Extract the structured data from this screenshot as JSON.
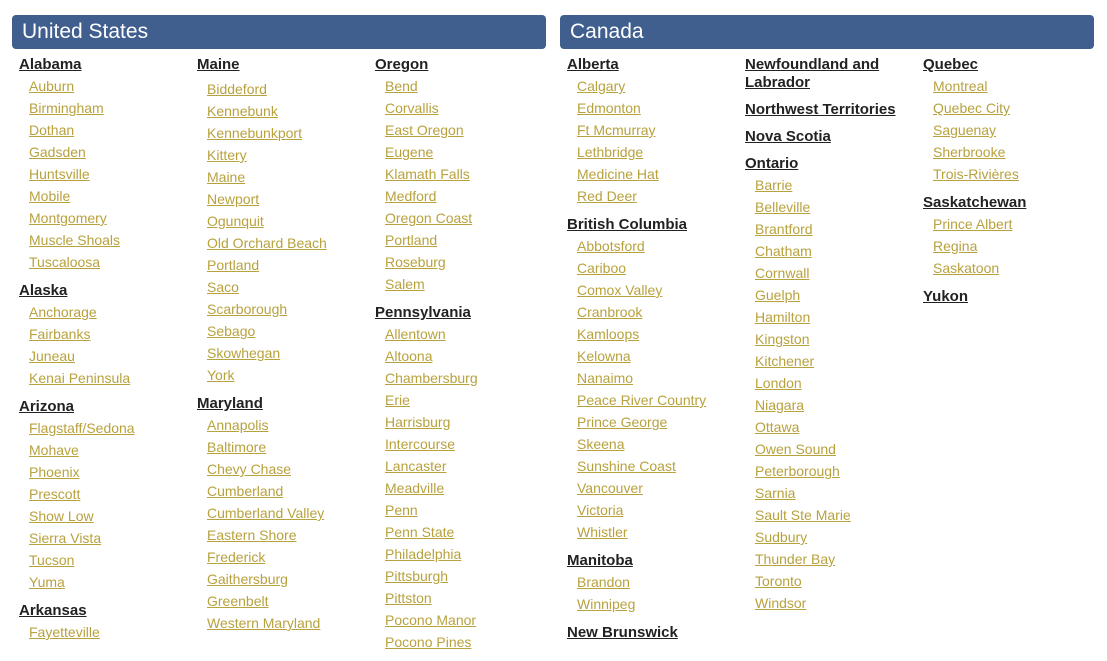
{
  "colors": {
    "header_bg": "#405e8e",
    "link": "#b8a23e",
    "region_title": "#222222"
  },
  "countries": [
    {
      "name": "United States",
      "columns": [
        [
          {
            "name": "Alabama",
            "cities": [
              "Auburn",
              "Birmingham",
              "Dothan",
              "Gadsden",
              "Huntsville",
              "Mobile",
              "Montgomery",
              "Muscle Shoals",
              "Tuscaloosa"
            ]
          },
          {
            "name": "Alaska",
            "cities": [
              "Anchorage",
              "Fairbanks",
              "Juneau",
              "Kenai Peninsula"
            ]
          },
          {
            "name": "Arizona",
            "cities": [
              "Flagstaff/Sedona",
              "Mohave",
              "Phoenix",
              "Prescott",
              "Show Low",
              "Sierra Vista",
              "Tucson",
              "Yuma"
            ]
          },
          {
            "name": "Arkansas",
            "cities": [
              "Fayetteville"
            ]
          }
        ],
        [
          {
            "name": "Maine",
            "cities": [
              "Biddeford",
              "Kennebunk",
              "Kennebunkport",
              "Kittery",
              "Maine",
              "Newport",
              "Ogunquit",
              "Old Orchard Beach",
              "Portland",
              "Saco",
              "Scarborough",
              "Sebago",
              "Skowhegan",
              "York"
            ]
          },
          {
            "name": "Maryland",
            "cities": [
              "Annapolis",
              "Baltimore",
              "Chevy Chase",
              "Cumberland",
              "Cumberland Valley",
              "Eastern Shore",
              "Frederick",
              "Gaithersburg",
              "Greenbelt",
              "Western Maryland"
            ]
          }
        ],
        [
          {
            "name": "Oregon",
            "cities": [
              "Bend",
              "Corvallis",
              "East Oregon",
              "Eugene",
              "Klamath Falls",
              "Medford",
              "Oregon Coast",
              "Portland",
              "Roseburg",
              "Salem"
            ]
          },
          {
            "name": "Pennsylvania",
            "cities": [
              "Allentown",
              "Altoona",
              "Chambersburg",
              "Erie",
              "Harrisburg",
              "Intercourse",
              "Lancaster",
              "Meadville",
              "Penn",
              "Penn State",
              "Philadelphia",
              "Pittsburgh",
              "Pittston",
              "Pocono Manor",
              "Pocono Pines"
            ]
          }
        ]
      ]
    },
    {
      "name": "Canada",
      "columns": [
        [
          {
            "name": "Alberta",
            "cities": [
              "Calgary",
              "Edmonton",
              "Ft Mcmurray",
              "Lethbridge",
              "Medicine Hat",
              "Red Deer"
            ]
          },
          {
            "name": "British Columbia",
            "cities": [
              "Abbotsford",
              "Cariboo",
              "Comox Valley",
              "Cranbrook",
              "Kamloops",
              "Kelowna",
              "Nanaimo",
              "Peace River Country",
              "Prince George",
              "Skeena",
              "Sunshine Coast",
              "Vancouver",
              "Victoria",
              "Whistler"
            ]
          },
          {
            "name": "Manitoba",
            "cities": [
              "Brandon",
              "Winnipeg"
            ]
          },
          {
            "name": "New Brunswick",
            "cities": []
          }
        ],
        [
          {
            "name": "Newfoundland and Labrador",
            "cities": []
          },
          {
            "name": "Northwest Territories",
            "cities": []
          },
          {
            "name": "Nova Scotia",
            "cities": []
          },
          {
            "name": "Ontario",
            "cities": [
              "Barrie",
              "Belleville",
              "Brantford",
              "Chatham",
              "Cornwall",
              "Guelph",
              "Hamilton",
              "Kingston",
              "Kitchener",
              "London",
              "Niagara",
              "Ottawa",
              "Owen Sound",
              "Peterborough",
              "Sarnia",
              "Sault Ste Marie",
              "Sudbury",
              "Thunder Bay",
              "Toronto",
              "Windsor"
            ]
          }
        ],
        [
          {
            "name": "Quebec",
            "cities": [
              "Montreal",
              "Quebec City",
              "Saguenay",
              "Sherbrooke",
              "Trois-Rivières"
            ]
          },
          {
            "name": "Saskatchewan",
            "cities": [
              "Prince Albert",
              "Regina",
              "Saskatoon"
            ]
          },
          {
            "name": "Yukon",
            "cities": []
          }
        ]
      ]
    }
  ]
}
